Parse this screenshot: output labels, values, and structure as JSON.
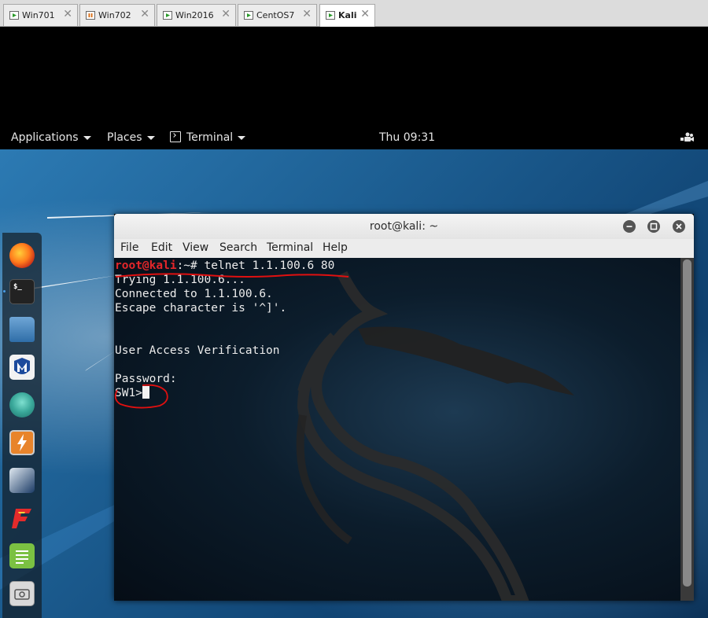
{
  "vm_tabs": [
    {
      "label": "Win701",
      "active": false
    },
    {
      "label": "Win702",
      "active": false
    },
    {
      "label": "Win2016",
      "active": false
    },
    {
      "label": "CentOS7",
      "active": false
    },
    {
      "label": "Kali",
      "active": true
    }
  ],
  "topbar": {
    "applications": "Applications",
    "places": "Places",
    "terminal": "Terminal",
    "clock": "Thu 09:31"
  },
  "dock_apps": [
    "firefox-icon",
    "terminal-icon",
    "files-icon",
    "metasploit-icon",
    "armitage-icon",
    "burpsuite-icon",
    "maltego-icon",
    "faraday-icon",
    "leafpad-icon",
    "cutycapt-icon"
  ],
  "terminal": {
    "title": "root@kali: ~",
    "menu": [
      "File",
      "Edit",
      "View",
      "Search",
      "Terminal",
      "Help"
    ],
    "prompt_user": "root@kali",
    "prompt_rest": ":~# ",
    "command": "telnet 1.1.100.6 80",
    "lines": [
      "Trying 1.1.100.6...",
      "Connected to 1.1.100.6.",
      "Escape character is '^]'.",
      "",
      "",
      "User Access Verification",
      "",
      "Password:"
    ],
    "current_prompt": "SW1>"
  },
  "colors": {
    "prompt_user": "#e3262a",
    "annotation": "#e01010"
  }
}
